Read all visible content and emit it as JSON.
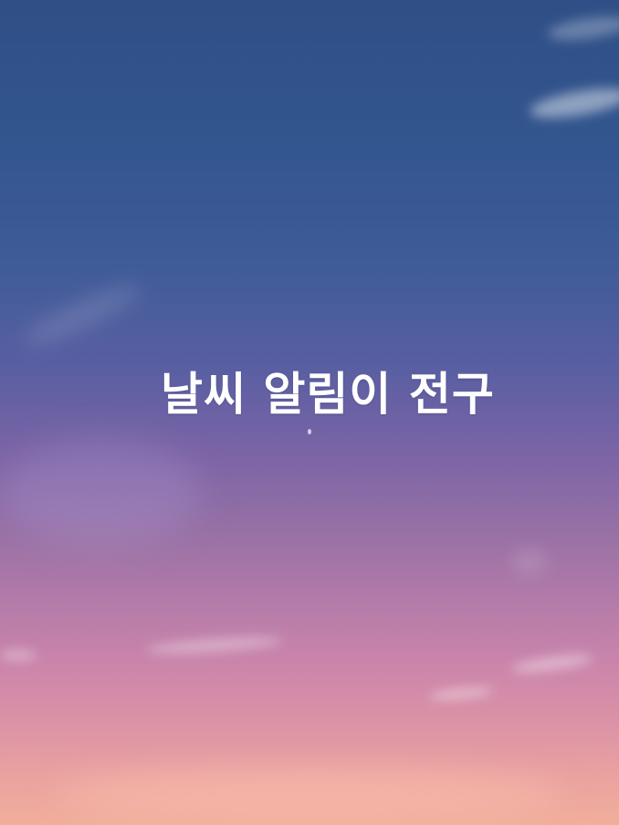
{
  "title": "날씨 알림이 전구",
  "colors": {
    "sky_top": "#2f4f86",
    "sky_middle": "#7b64a6",
    "sky_bottom": "#f1ae9b",
    "title_text": "#ffffff"
  }
}
